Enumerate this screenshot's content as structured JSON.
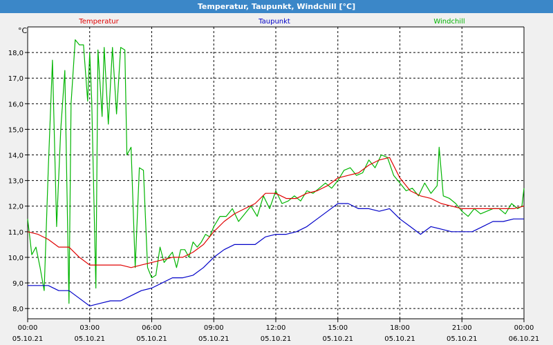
{
  "window": {
    "title": "Temperatur, Taupunkt, Windchill [°C]"
  },
  "chart_data": {
    "type": "line",
    "title": "Temperatur, Taupunkt, Windchill [°C]",
    "ylabel": "°C",
    "ylim": [
      7.6,
      19.0
    ],
    "xlim": [
      0,
      24
    ],
    "yticks": [
      8.0,
      9.0,
      10.0,
      11.0,
      12.0,
      13.0,
      14.0,
      15.0,
      16.0,
      17.0,
      18.0
    ],
    "ytick_labels": [
      "8,0",
      "9,0",
      "10,0",
      "11,0",
      "12,0",
      "13,0",
      "14,0",
      "15,0",
      "16,0",
      "17,0",
      "18,0"
    ],
    "xticks": [
      0,
      3,
      6,
      9,
      12,
      15,
      18,
      21,
      24
    ],
    "xtick_labels": [
      [
        "00:00",
        "05.10.21"
      ],
      [
        "03:00",
        "05.10.21"
      ],
      [
        "06:00",
        "05.10.21"
      ],
      [
        "09:00",
        "05.10.21"
      ],
      [
        "12:00",
        "05.10.21"
      ],
      [
        "15:00",
        "05.10.21"
      ],
      [
        "18:00",
        "05.10.21"
      ],
      [
        "21:00",
        "05.10.21"
      ],
      [
        "00:00",
        "06.10.21"
      ]
    ],
    "grid": true,
    "legend_placement": "top",
    "series": [
      {
        "name": "Temperatur",
        "color": "#e00000",
        "x": [
          0,
          0.5,
          1,
          1.5,
          2,
          2.5,
          3,
          3.5,
          4,
          4.5,
          5,
          5.5,
          6,
          6.5,
          7,
          7.5,
          8,
          8.5,
          9,
          9.5,
          10,
          10.5,
          11,
          11.5,
          12,
          12.5,
          13,
          13.5,
          14,
          14.5,
          15,
          15.5,
          16,
          16.5,
          17,
          17.5,
          18,
          18.5,
          19,
          19.5,
          20,
          20.5,
          21,
          21.5,
          22,
          22.5,
          23,
          23.5,
          24
        ],
        "values": [
          11.0,
          10.9,
          10.7,
          10.4,
          10.4,
          10.0,
          9.7,
          9.7,
          9.7,
          9.7,
          9.6,
          9.7,
          9.8,
          9.9,
          10.0,
          10.0,
          10.2,
          10.5,
          11.0,
          11.4,
          11.7,
          11.9,
          12.1,
          12.5,
          12.5,
          12.3,
          12.3,
          12.5,
          12.6,
          12.8,
          13.1,
          13.2,
          13.3,
          13.6,
          13.8,
          13.9,
          13.1,
          12.6,
          12.4,
          12.3,
          12.1,
          12.0,
          11.9,
          11.9,
          11.9,
          11.9,
          11.9,
          11.9,
          12.0
        ]
      },
      {
        "name": "Taupunkt",
        "color": "#0000c8",
        "x": [
          0,
          0.5,
          1,
          1.5,
          2,
          2.5,
          3,
          3.5,
          4,
          4.5,
          5,
          5.5,
          6,
          6.5,
          7,
          7.5,
          8,
          8.5,
          9,
          9.5,
          10,
          10.5,
          11,
          11.5,
          12,
          12.5,
          13,
          13.5,
          14,
          14.5,
          15,
          15.5,
          16,
          16.5,
          17,
          17.5,
          18,
          18.5,
          19,
          19.5,
          20,
          20.5,
          21,
          21.5,
          22,
          22.5,
          23,
          23.5,
          24
        ],
        "values": [
          8.9,
          8.9,
          8.9,
          8.7,
          8.7,
          8.4,
          8.1,
          8.2,
          8.3,
          8.3,
          8.5,
          8.7,
          8.8,
          9.0,
          9.2,
          9.2,
          9.3,
          9.6,
          10.0,
          10.3,
          10.5,
          10.5,
          10.5,
          10.8,
          10.9,
          10.9,
          11.0,
          11.2,
          11.5,
          11.8,
          12.1,
          12.1,
          11.9,
          11.9,
          11.8,
          11.9,
          11.5,
          11.2,
          10.9,
          11.2,
          11.1,
          11.0,
          11.0,
          11.0,
          11.2,
          11.4,
          11.4,
          11.5,
          11.5
        ]
      },
      {
        "name": "Windchill",
        "color": "#00b400",
        "x": [
          0,
          0.2,
          0.4,
          0.6,
          0.8,
          1.0,
          1.2,
          1.4,
          1.6,
          1.8,
          2.0,
          2.1,
          2.3,
          2.5,
          2.7,
          2.9,
          3.0,
          3.1,
          3.3,
          3.4,
          3.6,
          3.7,
          3.9,
          4.1,
          4.3,
          4.5,
          4.7,
          4.8,
          5.0,
          5.2,
          5.4,
          5.6,
          5.8,
          6.0,
          6.2,
          6.4,
          6.6,
          6.8,
          7.0,
          7.2,
          7.4,
          7.6,
          7.8,
          8.0,
          8.2,
          8.4,
          8.6,
          8.8,
          9.0,
          9.3,
          9.6,
          9.9,
          10.2,
          10.5,
          10.8,
          11.1,
          11.4,
          11.7,
          12.0,
          12.3,
          12.6,
          12.9,
          13.2,
          13.5,
          13.8,
          14.1,
          14.4,
          14.7,
          15.0,
          15.3,
          15.6,
          15.9,
          16.2,
          16.5,
          16.8,
          17.1,
          17.4,
          17.7,
          18.0,
          18.3,
          18.6,
          18.9,
          19.2,
          19.5,
          19.8,
          19.9,
          20.1,
          20.4,
          20.7,
          21.0,
          21.3,
          21.6,
          21.9,
          22.2,
          22.5,
          22.8,
          23.1,
          23.4,
          23.7,
          23.9,
          24.0
        ],
        "values": [
          11.5,
          10.1,
          10.4,
          9.6,
          8.7,
          13.5,
          17.7,
          11.2,
          15.0,
          17.3,
          8.2,
          16.0,
          18.5,
          18.3,
          18.3,
          16.1,
          18.0,
          16.1,
          8.8,
          18.1,
          15.5,
          18.2,
          15.2,
          18.2,
          15.6,
          18.2,
          18.1,
          14.0,
          14.3,
          9.6,
          13.5,
          13.4,
          9.6,
          9.2,
          9.3,
          10.4,
          9.8,
          10.0,
          10.2,
          9.6,
          10.3,
          10.3,
          10.0,
          10.6,
          10.4,
          10.6,
          10.9,
          10.8,
          11.2,
          11.6,
          11.6,
          11.9,
          11.4,
          11.7,
          12.0,
          11.6,
          12.4,
          11.9,
          12.6,
          12.1,
          12.2,
          12.4,
          12.2,
          12.6,
          12.5,
          12.7,
          12.9,
          12.7,
          13.0,
          13.4,
          13.5,
          13.2,
          13.3,
          13.8,
          13.5,
          14.0,
          13.9,
          13.2,
          12.9,
          12.6,
          12.7,
          12.4,
          12.9,
          12.5,
          12.8,
          14.3,
          12.4,
          12.3,
          12.1,
          11.8,
          11.6,
          11.9,
          11.7,
          11.8,
          11.9,
          11.9,
          11.7,
          12.1,
          11.9,
          12.0,
          12.7
        ]
      }
    ]
  }
}
